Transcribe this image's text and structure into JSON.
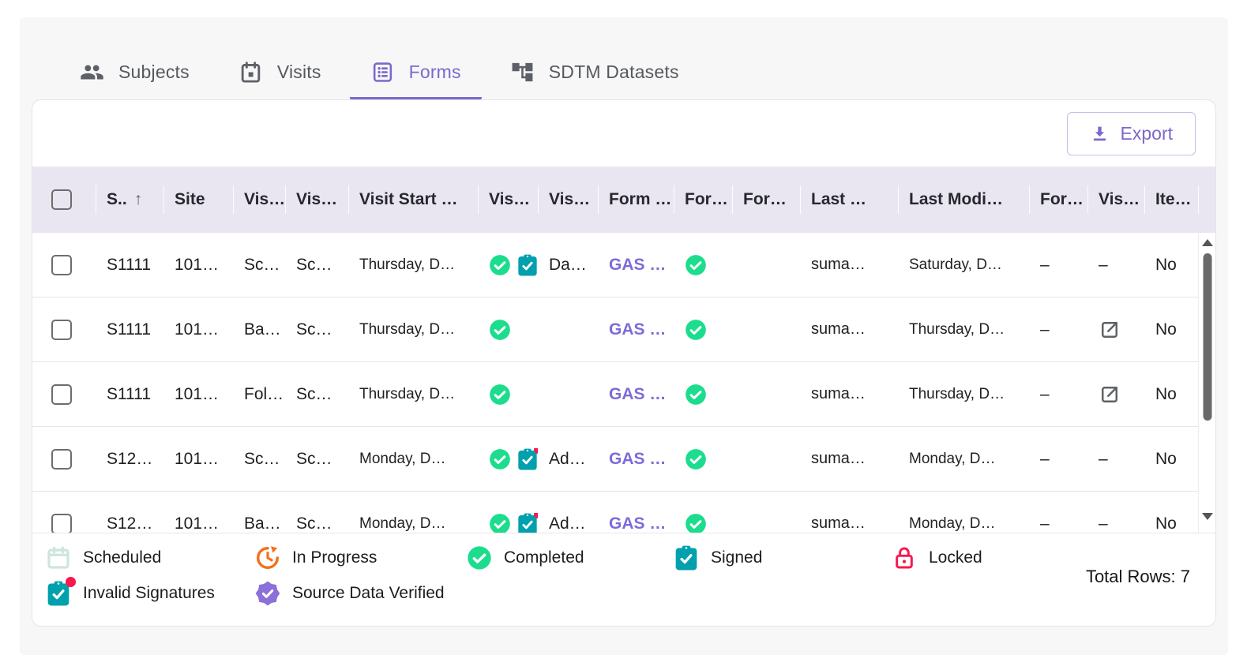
{
  "tabs": [
    {
      "label": "Subjects",
      "icon": "people",
      "active": false
    },
    {
      "label": "Visits",
      "icon": "calendar",
      "active": false
    },
    {
      "label": "Forms",
      "icon": "form",
      "active": true
    },
    {
      "label": "SDTM Datasets",
      "icon": "hierarchy",
      "active": false
    }
  ],
  "toolbar": {
    "export_label": "Export"
  },
  "table": {
    "columns": [
      {
        "key": "select",
        "label": "",
        "type": "checkbox"
      },
      {
        "key": "subject",
        "label": "S..",
        "sort": "asc"
      },
      {
        "key": "site",
        "label": "Site"
      },
      {
        "key": "visit-type",
        "label": "Vis…"
      },
      {
        "key": "visit-name",
        "label": "Vis…"
      },
      {
        "key": "visit-start",
        "label": "Visit Start …"
      },
      {
        "key": "visit-status",
        "label": "Vis…"
      },
      {
        "key": "visit-extra",
        "label": "Vis…"
      },
      {
        "key": "form-name",
        "label": "Form …"
      },
      {
        "key": "form-status",
        "label": "For…"
      },
      {
        "key": "form-extra",
        "label": "For…"
      },
      {
        "key": "last-modified-by",
        "label": "Last …"
      },
      {
        "key": "last-modified-date",
        "label": "Last Modi…"
      },
      {
        "key": "form-other",
        "label": "For…"
      },
      {
        "key": "visit-link",
        "label": "Vis…"
      },
      {
        "key": "item",
        "label": "Ite…"
      }
    ],
    "rows": [
      {
        "subject": "S1111",
        "site": "101…",
        "visit_type": "Sc…",
        "visit_name": "Sc…",
        "visit_start": "Thursday, D…",
        "visit_status": [
          "completed",
          "signed"
        ],
        "visit_extra": "Da…",
        "form_name": "GAS …",
        "form_status": [
          "completed"
        ],
        "form_extra": "",
        "last_modified_by": "suma…",
        "last_modified_date": "Saturday, D…",
        "form_other": "–",
        "visit_link": "–",
        "item": "No"
      },
      {
        "subject": "S1111",
        "site": "101…",
        "visit_type": "Ba…",
        "visit_name": "Sc…",
        "visit_start": "Thursday, D…",
        "visit_status": [
          "completed"
        ],
        "visit_extra": "",
        "form_name": "GAS …",
        "form_status": [
          "completed"
        ],
        "form_extra": "",
        "last_modified_by": "suma…",
        "last_modified_date": "Thursday, D…",
        "form_other": "–",
        "visit_link": "external-link",
        "item": "No"
      },
      {
        "subject": "S1111",
        "site": "101…",
        "visit_type": "Fol…",
        "visit_name": "Sc…",
        "visit_start": "Thursday, D…",
        "visit_status": [
          "completed"
        ],
        "visit_extra": "",
        "form_name": "GAS …",
        "form_status": [
          "completed"
        ],
        "form_extra": "",
        "last_modified_by": "suma…",
        "last_modified_date": "Thursday, D…",
        "form_other": "–",
        "visit_link": "external-link",
        "item": "No"
      },
      {
        "subject": "S12…",
        "site": "101…",
        "visit_type": "Sc…",
        "visit_name": "Sc…",
        "visit_start": "Monday, D…",
        "visit_status": [
          "completed",
          "signed-invalid"
        ],
        "visit_extra": "Ad…",
        "form_name": "GAS …",
        "form_status": [
          "completed"
        ],
        "form_extra": "",
        "last_modified_by": "suma…",
        "last_modified_date": "Monday, D…",
        "form_other": "–",
        "visit_link": "–",
        "item": "No"
      },
      {
        "subject": "S12…",
        "site": "101…",
        "visit_type": "Ba…",
        "visit_name": "Sc…",
        "visit_start": "Monday, D…",
        "visit_status": [
          "completed",
          "signed-invalid"
        ],
        "visit_extra": "Ad…",
        "form_name": "GAS …",
        "form_status": [
          "completed"
        ],
        "form_extra": "",
        "last_modified_by": "suma…",
        "last_modified_date": "Monday, D…",
        "form_other": "–",
        "visit_link": "–",
        "item": "No"
      }
    ]
  },
  "legend": {
    "items": [
      {
        "icon": "scheduled",
        "label": "Scheduled"
      },
      {
        "icon": "in-progress",
        "label": "In Progress"
      },
      {
        "icon": "completed",
        "label": "Completed"
      },
      {
        "icon": "signed",
        "label": "Signed"
      },
      {
        "icon": "locked",
        "label": "Locked"
      },
      {
        "icon": "invalid-signatures",
        "label": "Invalid Signatures"
      },
      {
        "icon": "source-data-verified",
        "label": "Source Data Verified"
      }
    ]
  },
  "footer": {
    "total_rows": "Total Rows: 7"
  },
  "colors": {
    "accent_purple": "#7c68c9",
    "link_purple": "#7d6bd8",
    "completed_green": "#1bdd8d",
    "signed_teal": "#00a0ad",
    "invalid_red": "#f8174e",
    "locked_red": "#f8174e",
    "in_progress_orange": "#f4701e",
    "verified_purple": "#8a70d8",
    "scheduled_mint": "#cfe4df",
    "header_bg": "#e9e6f1",
    "icon_gray": "#5d6066"
  }
}
